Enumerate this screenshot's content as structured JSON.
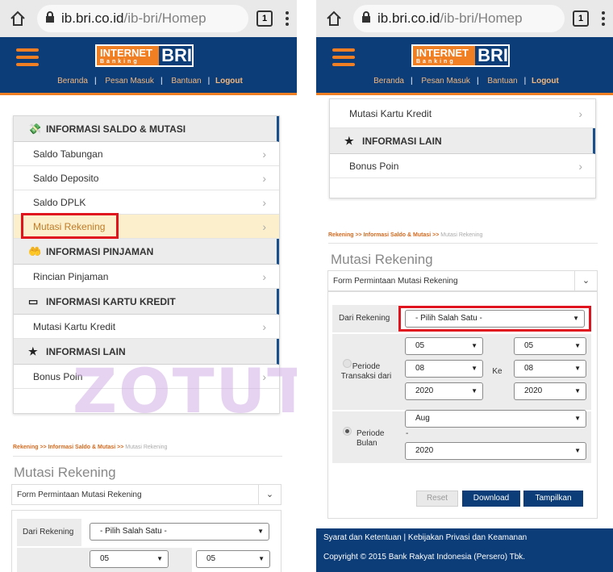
{
  "browser": {
    "url_host": "ib.bri.co.id",
    "url_path": "/ib-bri/Homep",
    "tab_count": "1"
  },
  "header": {
    "logo_internet": "INTERNET",
    "logo_banking": "Banking",
    "logo_bri": "BRI",
    "nav": [
      "Beranda",
      "Pesan Masuk",
      "Bantuan",
      "Logout"
    ]
  },
  "menu": {
    "saldo_title": "INFORMASI SALDO & MUTASI",
    "saldo_items": [
      "Saldo Tabungan",
      "Saldo Deposito",
      "Saldo DPLK",
      "Mutasi Rekening"
    ],
    "pinjaman_title": "INFORMASI PINJAMAN",
    "pinjaman_items": [
      "Rincian Pinjaman"
    ],
    "kartu_title": "INFORMASI KARTU KREDIT",
    "kartu_items": [
      "Mutasi Kartu Kredit"
    ],
    "lain_title": "INFORMASI LAIN",
    "lain_items": [
      "Bonus Poin"
    ]
  },
  "breadcrumb": {
    "part1": "Rekening >> Informasi Saldo & Mutasi >>",
    "current": "Mutasi Rekening"
  },
  "page_title": "Mutasi Rekening",
  "form": {
    "bar_title": "Form Permintaan Mutasi Rekening",
    "dari_rekening_label": "Dari Rekening",
    "dari_rekening_value": "- Pilih Salah Satu -",
    "periode_transaksi_label": "Periode Transaksi dari",
    "ke_label": "Ke",
    "from_day": "05",
    "from_month": "08",
    "from_year": "2020",
    "to_day": "05",
    "to_month": "08",
    "to_year": "2020",
    "periode_bulan_label": "Periode Bulan",
    "bulan_value": "Aug",
    "dash": "-",
    "tahun_value": "2020",
    "reset_label": "Reset",
    "download_label": "Download",
    "tampilkan_label": "Tampilkan"
  },
  "footer": {
    "links": "Syarat dan Ketentuan | Kebijakan Privasi dan Keamanan",
    "copyright": "Copyright © 2015 Bank Rakyat Indonesia (Persero) Tbk."
  },
  "watermark": "ZOTUTORIAL.COM",
  "colors": {
    "brand_blue": "#0c3d78",
    "brand_orange": "#f07e22",
    "highlight_red": "#e0141e"
  }
}
